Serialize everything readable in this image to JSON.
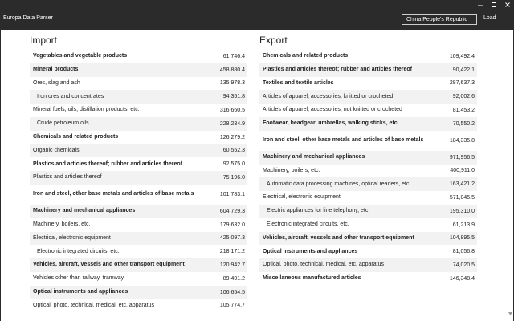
{
  "app": {
    "title": "Europa Data Parser"
  },
  "search": {
    "value": "China People's Republic"
  },
  "toolbar": {
    "load_label": "Load"
  },
  "import": {
    "title": "Import",
    "rows": [
      {
        "label": "Vegetables and vegetable products",
        "value": "61,746.4",
        "level": "main"
      },
      {
        "label": "Mineral products",
        "value": "458,880.4",
        "level": "main"
      },
      {
        "label": "Ores, slag and ash",
        "value": "135,978.3",
        "level": "sub1"
      },
      {
        "label": "Iron ores and concentrates",
        "value": "94,351.8",
        "level": "sub2"
      },
      {
        "label": "Mineral fuels, oils, distillation products, etc.",
        "value": "316,660.5",
        "level": "sub1"
      },
      {
        "label": "Crude petroleum oils",
        "value": "228,234.9",
        "level": "sub2"
      },
      {
        "label": "Chemicals and related products",
        "value": "126,279.2",
        "level": "main"
      },
      {
        "label": "Organic chemicals",
        "value": "60,552.3",
        "level": "sub1"
      },
      {
        "label": "Plastics and articles thereof; rubber and articles thereof",
        "value": "92,575.0",
        "level": "main"
      },
      {
        "label": "Plastics and articles thereof",
        "value": "75,196.0",
        "level": "sub1"
      },
      {
        "label": "Iron and steel, other base metals and articles of base metals",
        "value": "101,783.1",
        "level": "main"
      },
      {
        "label": "Machinery and mechanical appliances",
        "value": "604,729.3",
        "level": "main"
      },
      {
        "label": "Machinery, boilers, etc.",
        "value": "179,632.0",
        "level": "sub1"
      },
      {
        "label": "Electrical, electronic equipment",
        "value": "425,097.3",
        "level": "sub1"
      },
      {
        "label": "Electronic integrated circuits, etc.",
        "value": "218,171.2",
        "level": "sub2"
      },
      {
        "label": "Vehicles, aircraft, vessels and other transport equipment",
        "value": "120,942.7",
        "level": "main"
      },
      {
        "label": "Vehicles other than railway, tramway",
        "value": "89,491.2",
        "level": "sub1"
      },
      {
        "label": "Optical instruments and appliances",
        "value": "106,654.5",
        "level": "main"
      },
      {
        "label": "Optical, photo, technical, medical, etc. apparatus",
        "value": "105,774.7",
        "level": "sub1"
      }
    ]
  },
  "export": {
    "title": "Export",
    "rows": [
      {
        "label": "Chemicals and related products",
        "value": "109,492.4",
        "level": "main"
      },
      {
        "label": "Plastics and articles thereof; rubber and articles thereof",
        "value": "90,422.1",
        "level": "main"
      },
      {
        "label": "Textiles and textile articles",
        "value": "287,637.3",
        "level": "main"
      },
      {
        "label": "Articles of apparel, accessories, knitted or crocheted",
        "value": "92,002.6",
        "level": "sub1"
      },
      {
        "label": "Articles of apparel, accessories, not knitted or crocheted",
        "value": "81,453.2",
        "level": "sub1"
      },
      {
        "label": "Footwear, headgear, umbrellas, walking sticks, etc.",
        "value": "70,550.2",
        "level": "main"
      },
      {
        "label": "Iron and steel, other base metals and articles of base metals",
        "value": "184,335.8",
        "level": "main"
      },
      {
        "label": "Machinery and mechanical appliances",
        "value": "971,956.5",
        "level": "main"
      },
      {
        "label": "Machinery, boilers, etc.",
        "value": "400,911.0",
        "level": "sub1"
      },
      {
        "label": "Automatic data processing machines, optical readers, etc.",
        "value": "163,421.2",
        "level": "sub2"
      },
      {
        "label": "Electrical, electronic equipment",
        "value": "571,045.5",
        "level": "sub1"
      },
      {
        "label": "Electric appliances for line telephony, etc.",
        "value": "195,310.0",
        "level": "sub2"
      },
      {
        "label": "Electronic integrated circuits, etc.",
        "value": "61,213.9",
        "level": "sub2"
      },
      {
        "label": "Vehicles, aircraft, vessels and other transport equipment",
        "value": "104,895.5",
        "level": "main"
      },
      {
        "label": "Optical instruments and appliances",
        "value": "81,056.8",
        "level": "main"
      },
      {
        "label": "Optical, photo, technical, medical, etc. apparatus",
        "value": "74,020.5",
        "level": "sub1"
      },
      {
        "label": "Miscellaneous manufactured articles",
        "value": "146,348.4",
        "level": "main"
      }
    ]
  }
}
